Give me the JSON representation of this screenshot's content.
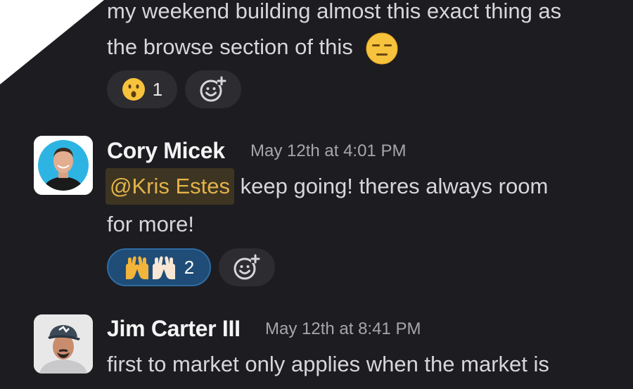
{
  "messages": [
    {
      "lines": [
        "my weekend building almost this exact thing as",
        "the browse section of this"
      ],
      "inline_emoji": "expressionless-face-icon",
      "reactions": [
        {
          "emoji": "hushed-face-icon",
          "count": "1",
          "active": false
        }
      ]
    },
    {
      "author": "Cory Micek",
      "timestamp": "May 12th at 4:01 PM",
      "mention": "@Kris Estes",
      "line1_rest": " keep going! theres always room",
      "line2": "for more!",
      "reactions": [
        {
          "emoji": "raising-hands-icon",
          "count": "2",
          "active": true
        }
      ]
    },
    {
      "author": "Jim Carter III",
      "timestamp": "May 12th at 8:41 PM",
      "line1": "first to market only applies when the market is"
    }
  ],
  "colors": {
    "background": "#1d1c20",
    "text": "#d7d6d9",
    "mention_bg": "#3d3522",
    "mention_text": "#e3b24a",
    "active_reaction": "#1f4d78"
  }
}
